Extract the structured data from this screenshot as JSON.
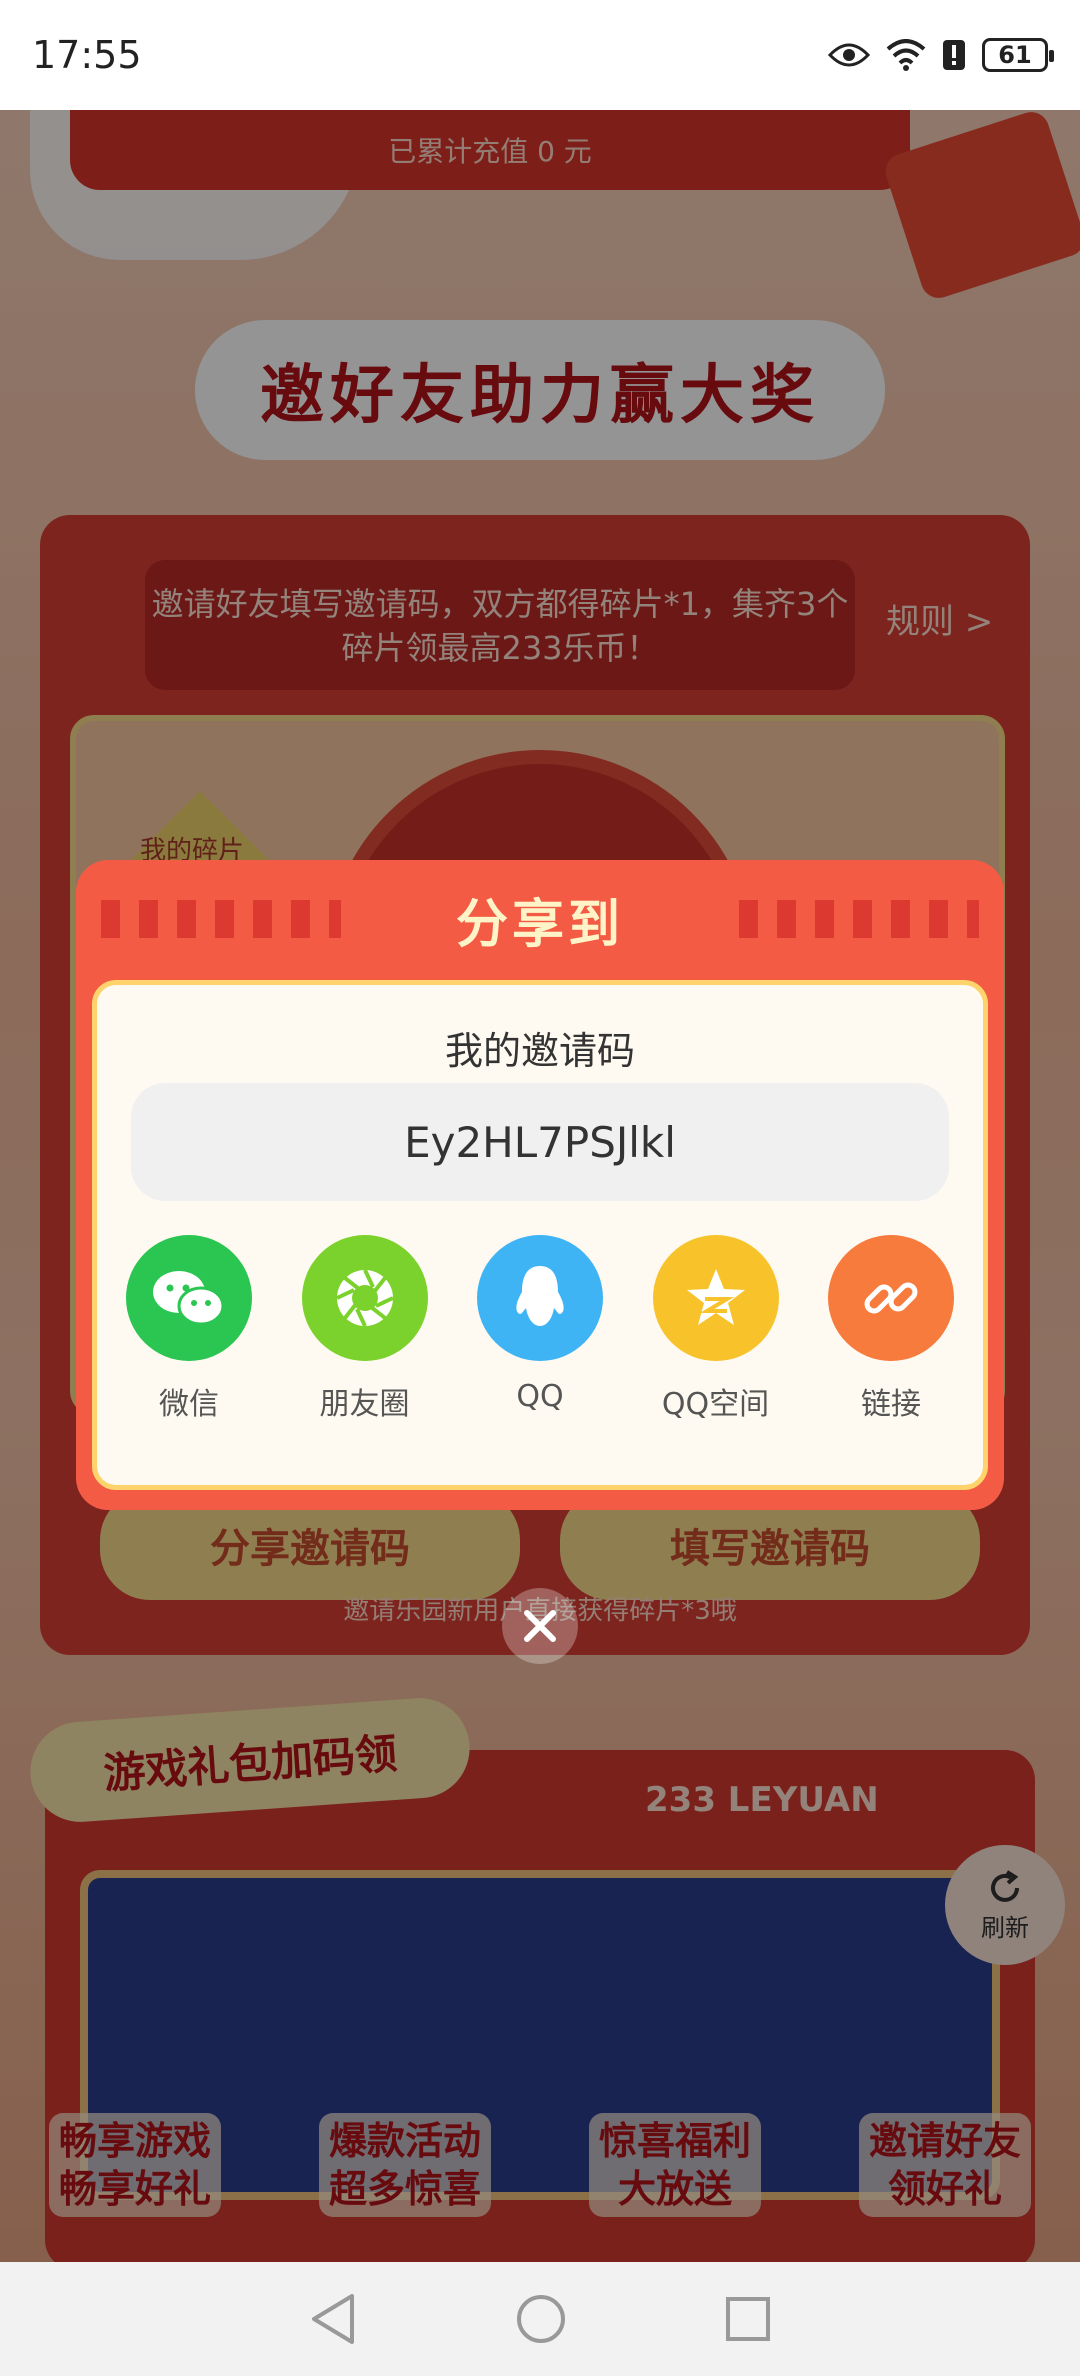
{
  "status_bar": {
    "time": "17:55",
    "battery": "61"
  },
  "background": {
    "recharge_text": "已累计充值 0 元",
    "main_title": "邀好友助力赢大奖",
    "description": "邀请好友填写邀请码，双方都得碎片*1，集齐3个碎片领最高233乐币！",
    "rules_link": "规则 >",
    "fragment_label": "我的碎片",
    "share_invite_button": "分享邀请码",
    "fill_invite_button": "填写邀请码",
    "hint": "邀请乐园新用户直接获得碎片*3哦",
    "gift_section_title": "游戏礼包加码领",
    "leyuan_brand": "233 LEYUAN",
    "refresh_label": "刷新",
    "promos": [
      {
        "line1": "畅享游戏",
        "line2": "畅享好礼"
      },
      {
        "line1": "爆款活动",
        "line2": "超多惊喜"
      },
      {
        "line1": "惊喜福利",
        "line2": "大放送"
      },
      {
        "line1": "邀请好友",
        "line2": "领好礼"
      }
    ]
  },
  "modal": {
    "title": "分享到",
    "code_title": "我的邀请码",
    "invite_code": "Ey2HL7PSJlkl",
    "share_targets": [
      {
        "label": "微信",
        "icon": "wechat-icon",
        "color": "#2ac651"
      },
      {
        "label": "朋友圈",
        "icon": "moments-icon",
        "color": "#7cd22c"
      },
      {
        "label": "QQ",
        "icon": "qq-icon",
        "color": "#3fb4f5"
      },
      {
        "label": "QQ空间",
        "icon": "qzone-icon",
        "color": "#f8c22a"
      },
      {
        "label": "链接",
        "icon": "link-icon",
        "color": "#f77b3d"
      }
    ]
  }
}
